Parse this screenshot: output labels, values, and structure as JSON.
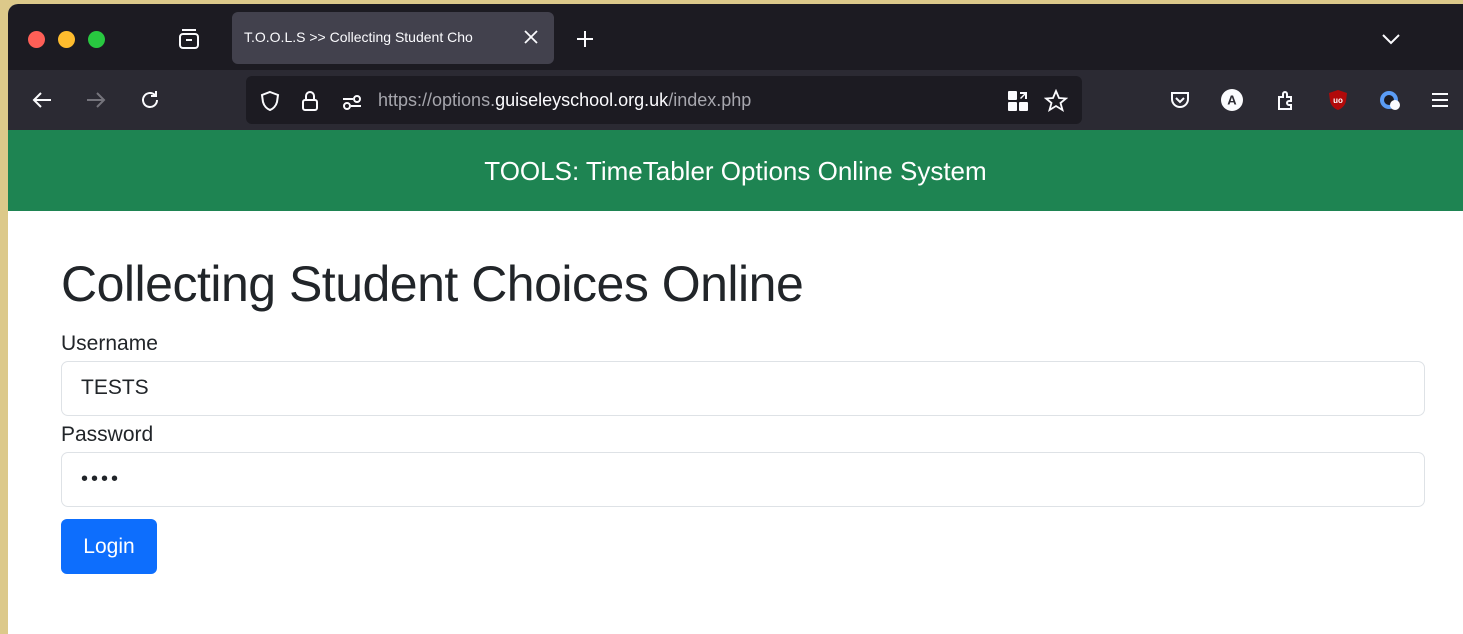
{
  "browser": {
    "tab_title": "T.O.O.L.S >> Collecting Student Cho",
    "url_prefix": "https://options.",
    "url_domain": "guiseleyschool.org.uk",
    "url_path": "/index.php"
  },
  "page": {
    "banner": "TOOLS: TimeTabler Options Online System",
    "heading": "Collecting Student Choices Online",
    "username_label": "Username",
    "username_value": "TESTS",
    "password_label": "Password",
    "password_mask": "••••",
    "login_label": "Login"
  },
  "colors": {
    "banner": "#1e8452",
    "login_button": "#0d6efd",
    "tab_bar": "#1c1b22",
    "nav_bar": "#2b2a33"
  },
  "icons": [
    "tab-overview-icon",
    "close-icon",
    "plus-icon",
    "chevron-down-icon",
    "back-arrow-icon",
    "forward-arrow-icon",
    "reload-icon",
    "shield-icon",
    "lock-icon",
    "permissions-icon",
    "qr-code-icon",
    "star-icon",
    "pocket-icon",
    "account-icon",
    "extensions-icon",
    "ublock-icon",
    "extension-icon",
    "menu-icon"
  ]
}
